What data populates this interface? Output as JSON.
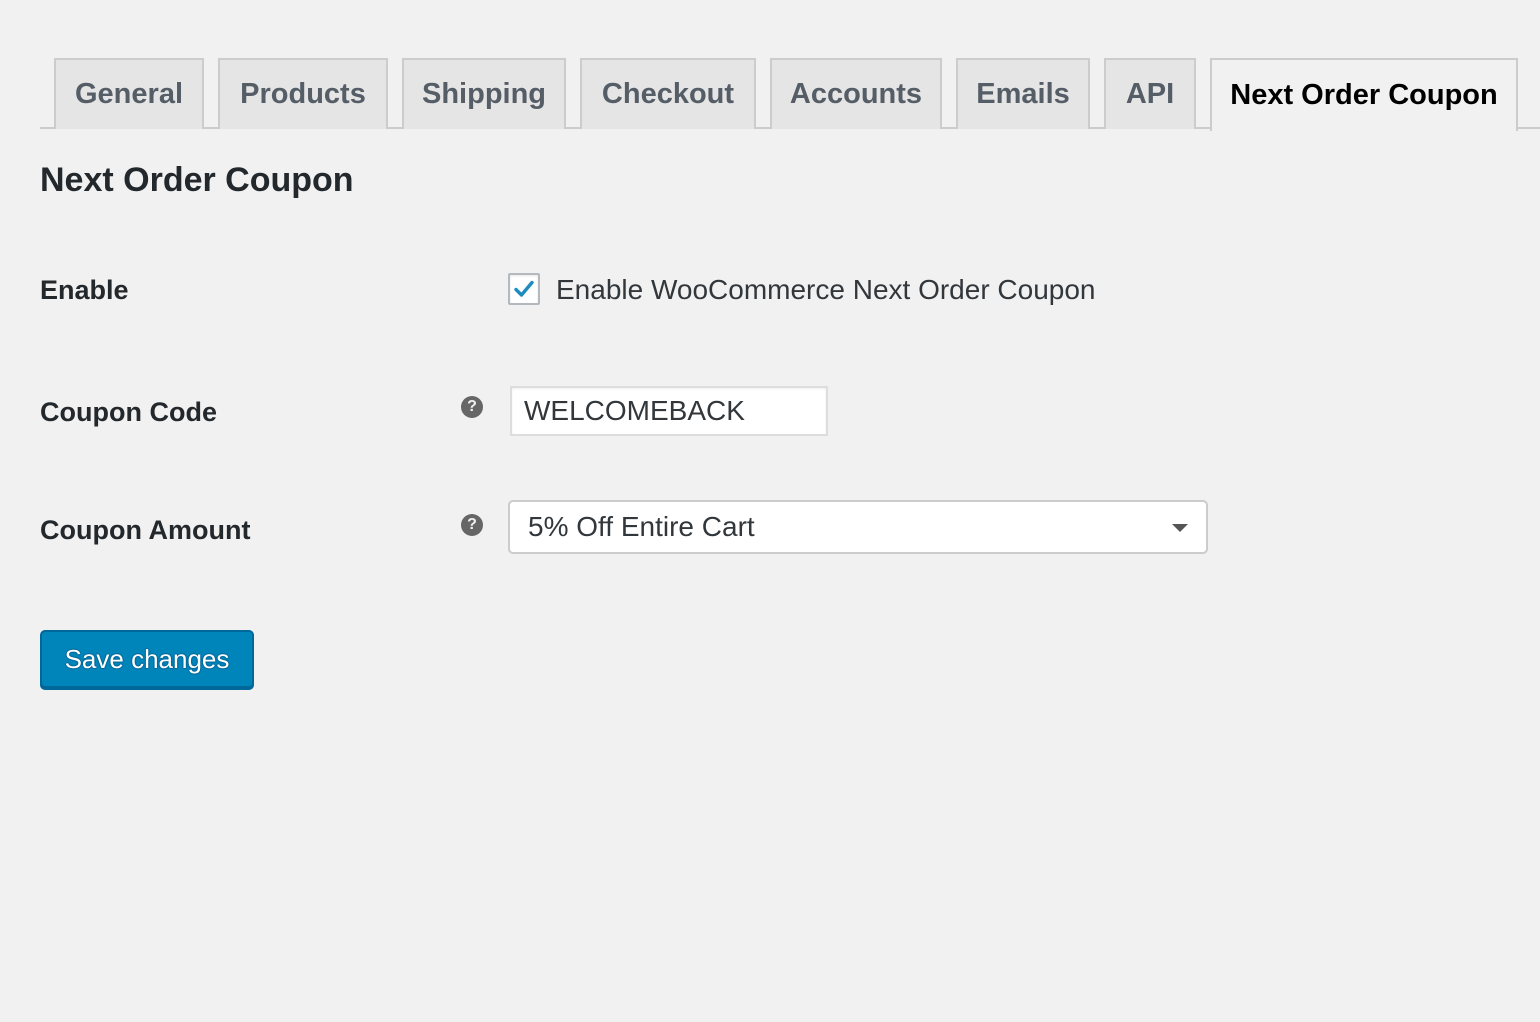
{
  "tabs": [
    {
      "label": "General",
      "active": false
    },
    {
      "label": "Products",
      "active": false
    },
    {
      "label": "Shipping",
      "active": false
    },
    {
      "label": "Checkout",
      "active": false
    },
    {
      "label": "Accounts",
      "active": false
    },
    {
      "label": "Emails",
      "active": false
    },
    {
      "label": "API",
      "active": false
    },
    {
      "label": "Next Order Coupon",
      "active": true
    }
  ],
  "page": {
    "title": "Next Order Coupon"
  },
  "form": {
    "enable": {
      "label": "Enable",
      "checkbox_label": "Enable WooCommerce Next Order Coupon",
      "checked": true
    },
    "coupon_code": {
      "label": "Coupon Code",
      "value": "WELCOMEBACK",
      "help_icon": "question-circle-icon"
    },
    "coupon_amount": {
      "label": "Coupon Amount",
      "selected": "5% Off Entire Cart",
      "help_icon": "question-circle-icon"
    }
  },
  "actions": {
    "save_label": "Save changes"
  },
  "colors": {
    "background": "#f1f1f1",
    "primary_button": "#0085ba",
    "checkmark": "#1e8cbe"
  }
}
